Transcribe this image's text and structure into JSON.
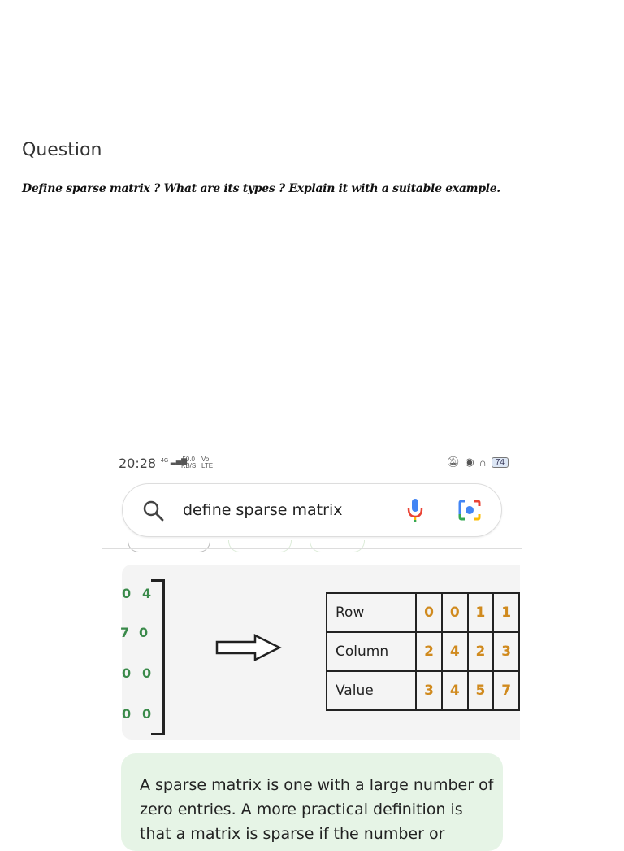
{
  "question": {
    "heading": "Question",
    "text": "Define sparse matrix ? What are its types ? Explain it with a suitable example."
  },
  "status_bar": {
    "time": "20:28",
    "network": "4G",
    "speed_value": "50.0",
    "speed_unit": "KB/S",
    "volte": "Vo",
    "lte": "LTE",
    "battery": "74"
  },
  "search": {
    "query": "define sparse matrix"
  },
  "figure": {
    "matrix_rows": [
      [
        "0",
        "4"
      ],
      [
        "7",
        "0"
      ],
      [
        "0",
        "0"
      ],
      [
        "0",
        "0"
      ]
    ],
    "table": [
      {
        "label": "Row",
        "values": [
          "0",
          "0",
          "1",
          "1"
        ]
      },
      {
        "label": "Column",
        "values": [
          "2",
          "4",
          "2",
          "3"
        ]
      },
      {
        "label": "Value",
        "values": [
          "3",
          "4",
          "5",
          "7"
        ]
      }
    ]
  },
  "answer": {
    "text": "A sparse matrix is one with a large number of zero entries. A more practical definition is that a matrix is sparse if the number or"
  },
  "icons": [
    "search-icon",
    "mic-icon",
    "camera-lens-icon",
    "mute-icon",
    "alarm-icon",
    "headphones-icon",
    "battery-icon",
    "signal-icon",
    "right-arrow-icon"
  ],
  "colors": {
    "answer_bg": "#e6f4e6",
    "matrix_digits": "#3a8a4a",
    "table_values": "#d08a1e"
  }
}
